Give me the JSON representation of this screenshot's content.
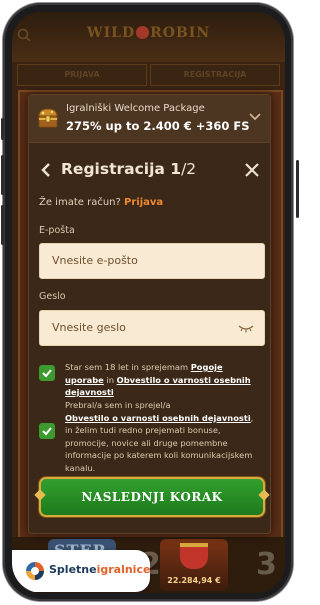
{
  "site": {
    "logo_left": "WILD",
    "logo_right": "ROBIN",
    "tabs": [
      "PRIJAVA",
      "REGISTRACIJA"
    ]
  },
  "promo": {
    "label": "Igralniški Welcome Package",
    "value": "275% up to 2.400 € +360 FS",
    "icon": "treasure-chest-icon"
  },
  "modal": {
    "title": "Registracija 1",
    "step_total": "/2",
    "account_question": "Že imate račun?",
    "login_link": "Prijava"
  },
  "form": {
    "email_label": "E-pošta",
    "email_placeholder": "Vnesite e-pošto",
    "password_label": "Geslo",
    "password_placeholder": "Vnesite geslo"
  },
  "consents": {
    "age_prefix": "Star sem 18 let in sprejemam",
    "age_link_terms": "Pogoje uporabe",
    "age_mid": "in",
    "age_link_privacy": "Obvestilo o varnosti osebnih dejavnosti",
    "privacy_prefix": "Prebral/a sem in sprejel/a",
    "privacy_link": "Obvestilo o varnosti osebnih dejavnosti",
    "privacy_suffix": ", in želim tudi redno prejemati bonuse, promocije, novice ali druge pomembne informacije po katerem koli komunikacijskem kanalu."
  },
  "next_button": "NASLEDNJI KORAK",
  "games": {
    "jackpot": "22.284,94 €",
    "tile_title": "STEP",
    "number_2": "2",
    "number_3": "3"
  },
  "badge": {
    "part1": "Spletne",
    "part2": "igralnice"
  },
  "colors": {
    "accent_orange": "#ef8a2e",
    "button_green": "#2a8f26",
    "check_green": "#3c9a2e",
    "modal_bg": "#3b2818"
  }
}
